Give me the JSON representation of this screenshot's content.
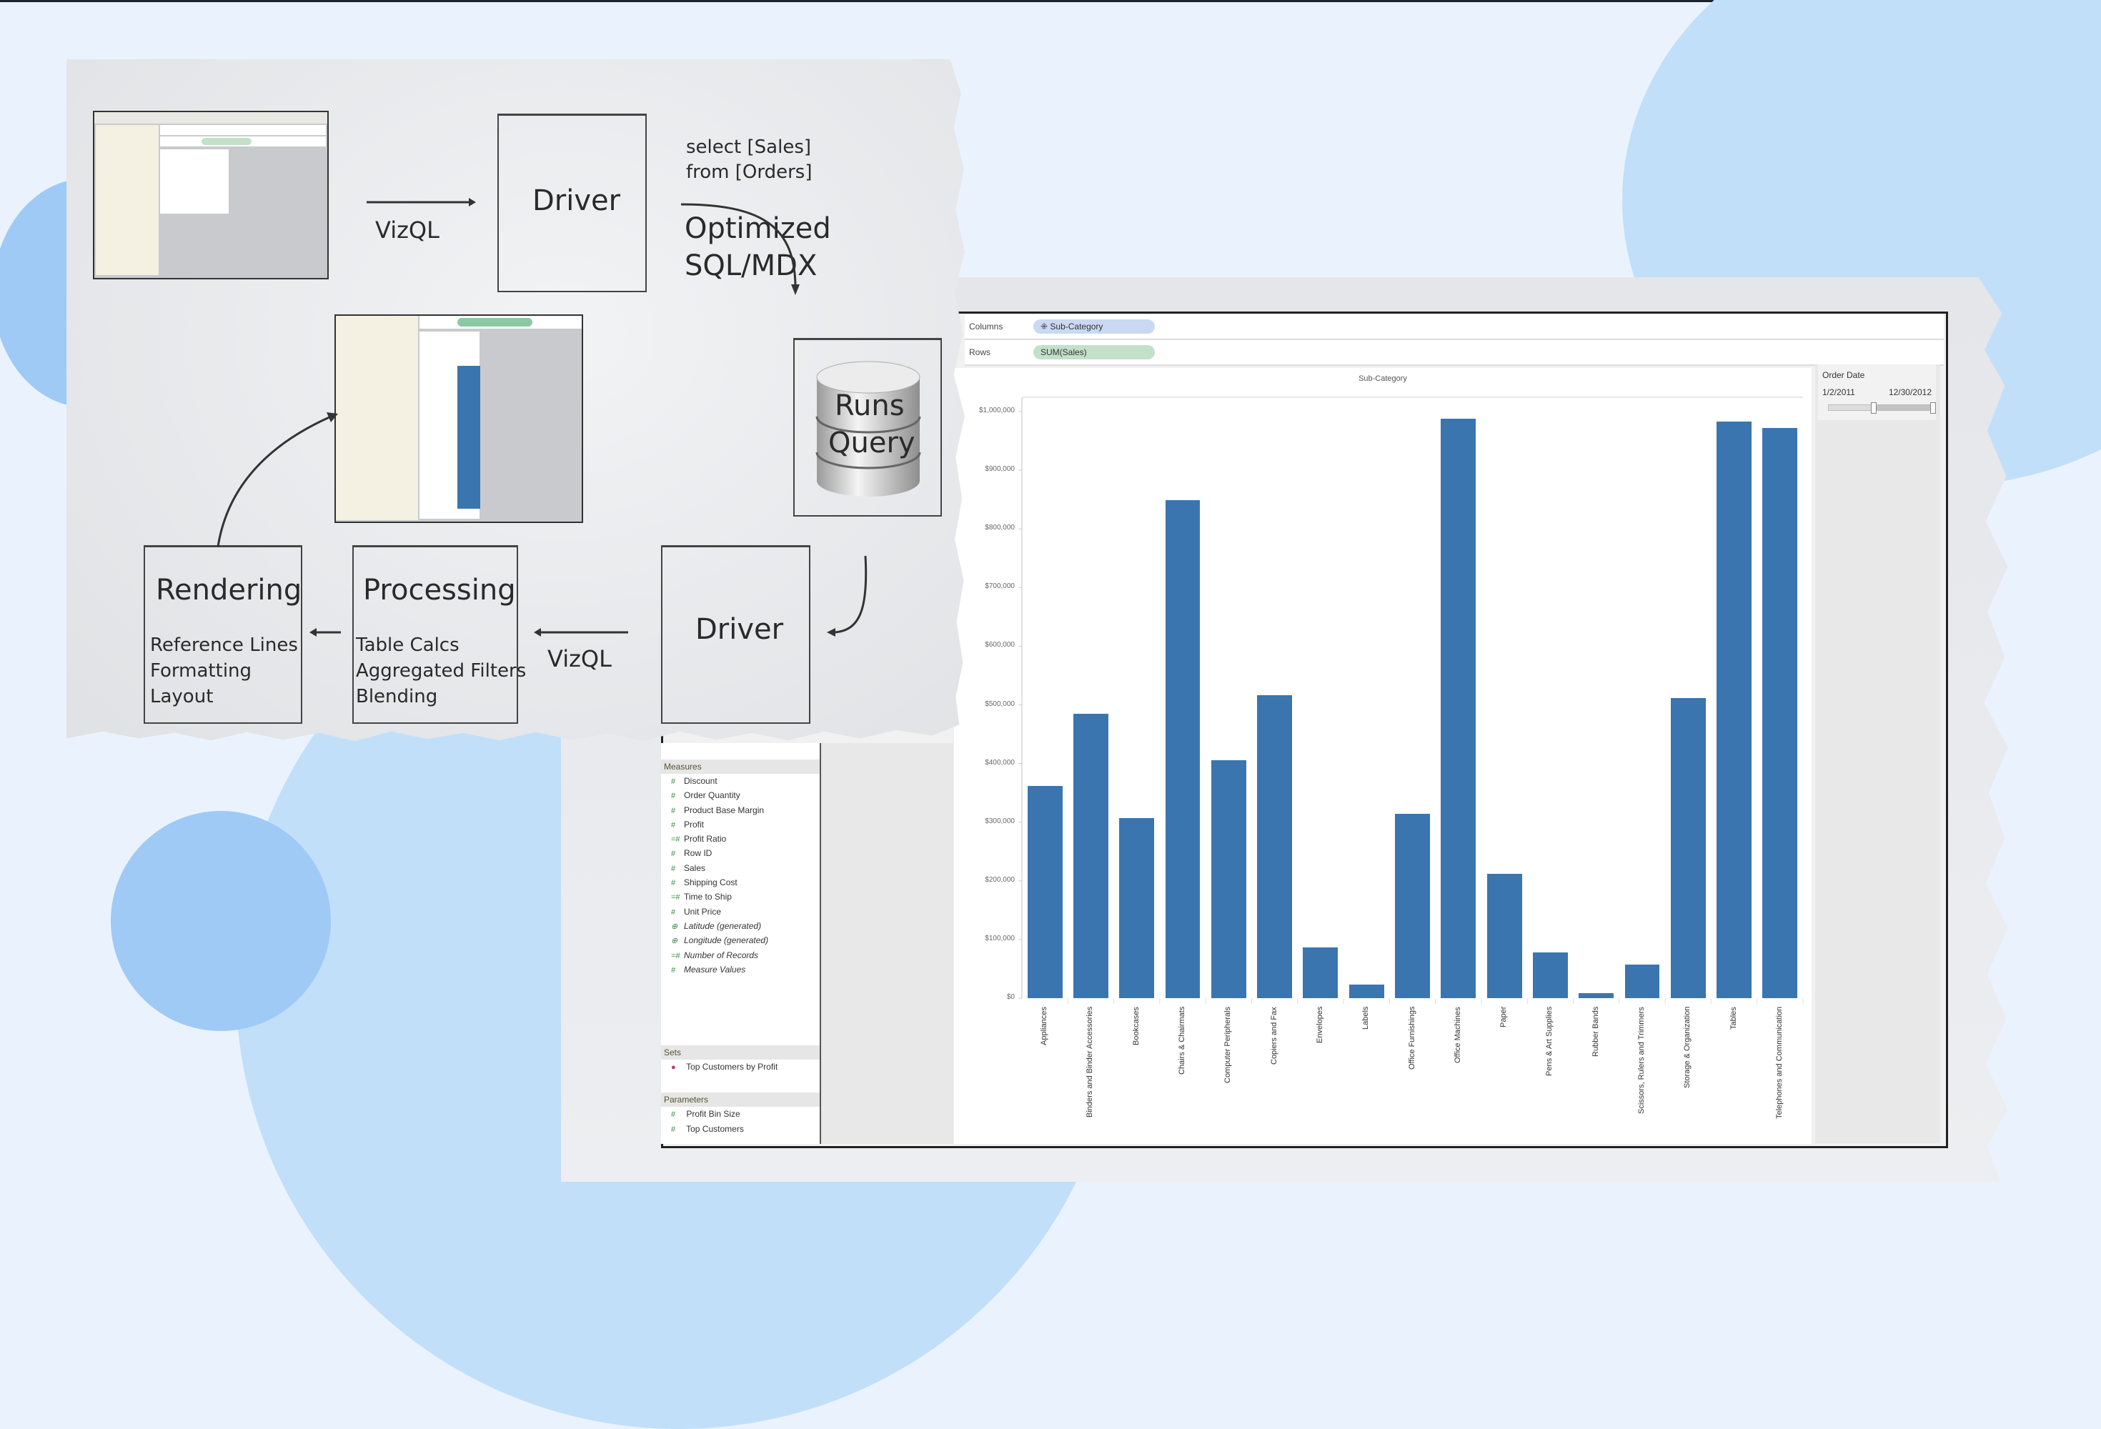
{
  "diagram": {
    "step1_arrow_label": "VizQL",
    "driver_top": "Driver",
    "sql_line1": "select [Sales]",
    "sql_line2": "from [Orders]",
    "optimized_line1": "Optimized",
    "optimized_line2": "SQL/MDX",
    "db_line1": "Runs",
    "db_line2": "Query",
    "driver_bottom": "Driver",
    "step2_arrow_label": "VizQL",
    "processing": {
      "title": "Processing",
      "items": [
        "Table Calcs",
        "Aggregated Filters",
        "Blending"
      ]
    },
    "rendering": {
      "title": "Rendering",
      "items": [
        "Reference Lines",
        "Formatting",
        "Layout"
      ]
    }
  },
  "tableau": {
    "columns_label": "Columns",
    "columns_pill": "⁜ Sub-Category",
    "rows_label": "Rows",
    "rows_pill": "SUM(Sales)",
    "measures_header": "Measures",
    "measures": [
      {
        "icon": "#",
        "name": "Discount",
        "italic": false
      },
      {
        "icon": "#",
        "name": "Order Quantity",
        "italic": false
      },
      {
        "icon": "#",
        "name": "Product Base Margin",
        "italic": false
      },
      {
        "icon": "#",
        "name": "Profit",
        "italic": false
      },
      {
        "icon": "=#",
        "name": "Profit Ratio",
        "italic": false
      },
      {
        "icon": "#",
        "name": "Row ID",
        "italic": false
      },
      {
        "icon": "#",
        "name": "Sales",
        "italic": false
      },
      {
        "icon": "#",
        "name": "Shipping Cost",
        "italic": false
      },
      {
        "icon": "=#",
        "name": "Time to Ship",
        "italic": false
      },
      {
        "icon": "#",
        "name": "Unit Price",
        "italic": false
      },
      {
        "icon": "⊕",
        "name": "Latitude (generated)",
        "italic": true
      },
      {
        "icon": "⊕",
        "name": "Longitude (generated)",
        "italic": true
      },
      {
        "icon": "=#",
        "name": "Number of Records",
        "italic": true
      },
      {
        "icon": "#",
        "name": "Measure Values",
        "italic": true
      }
    ],
    "sets_header": "Sets",
    "sets": [
      "Top Customers by Profit"
    ],
    "parameters_header": "Parameters",
    "parameters": [
      "Profit Bin Size",
      "Top Customers"
    ],
    "filter": {
      "title": "Order Date",
      "from": "1/2/2011",
      "to": "12/30/2012",
      "range_start": 0.42,
      "range_end": 1.0
    }
  },
  "chart_data": {
    "type": "bar",
    "title": "Sub-Category",
    "xlabel": "",
    "ylabel": "",
    "ylim": [
      0,
      1000000
    ],
    "yticks": [
      0,
      100000,
      200000,
      300000,
      400000,
      500000,
      600000,
      700000,
      800000,
      900000,
      1000000
    ],
    "ytick_labels": [
      "$0",
      "$100,000",
      "$200,000",
      "$300,000",
      "$400,000",
      "$500,000",
      "$600,000",
      "$700,000",
      "$800,000",
      "$900,000",
      "$1,000,000"
    ],
    "color": "#3b75af",
    "categories": [
      "Appliances",
      "Binders and Binder Accessories",
      "Bookcases",
      "Chairs & Chairmats",
      "Computer Peripherals",
      "Copiers and Fax",
      "Envelopes",
      "Labels",
      "Office Furnishings",
      "Office Machines",
      "Paper",
      "Pens & Art Supplies",
      "Rubber Bands",
      "Scissors, Rulers and Trimmers",
      "Storage & Organization",
      "Tables",
      "Telephones and Communication"
    ],
    "values": [
      362000,
      485000,
      307000,
      849000,
      406000,
      517000,
      87000,
      23000,
      314000,
      988000,
      212000,
      78000,
      8000,
      57000,
      511000,
      983000,
      972000
    ]
  }
}
